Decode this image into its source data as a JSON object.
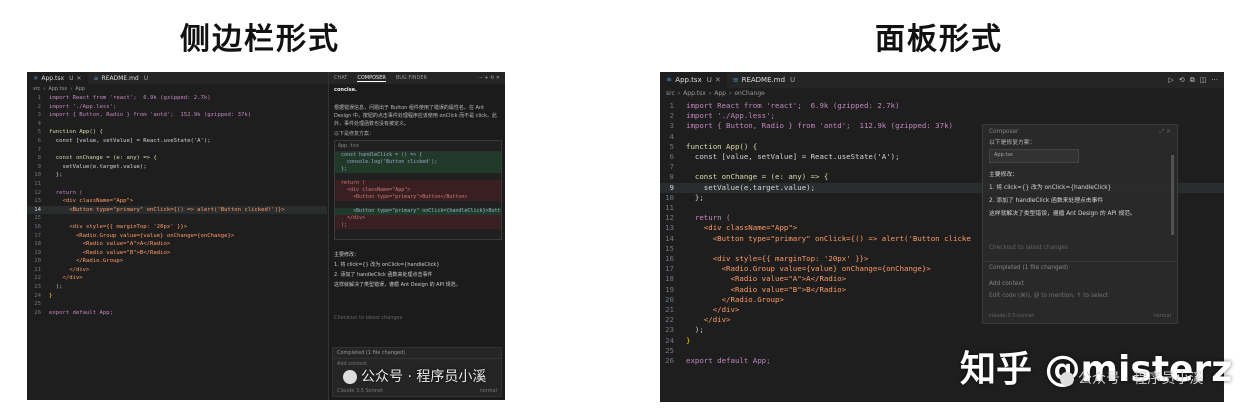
{
  "headings": {
    "left": "侧边栏形式",
    "right": "面板形式"
  },
  "editor": {
    "tabs": [
      {
        "label": "App.tsx",
        "status": "U",
        "active": true
      },
      {
        "label": "README.md",
        "status": "U",
        "active": false
      }
    ],
    "breadcrumb": [
      "src",
      "App.tsx",
      "App"
    ],
    "right_breadcrumb": [
      "src",
      "App.tsx",
      "App",
      "onChange"
    ],
    "lines": [
      {
        "n": "1",
        "text": "import React from 'react';  6.9k (gzipped: 2.7k)",
        "cls": "kw-import"
      },
      {
        "n": "2",
        "text": "import './App.less';",
        "cls": "kw-import"
      },
      {
        "n": "3",
        "text": "import { Button, Radio } from 'antd';  152.9k (gzipped: 37k)",
        "cls": "kw-import"
      },
      {
        "n": "4",
        "text": "",
        "cls": ""
      },
      {
        "n": "5",
        "text": "function App() {",
        "cls": "fn"
      },
      {
        "n": "6",
        "text": "  const [value, setValue] = React.useState('A');",
        "cls": "txt"
      },
      {
        "n": "7",
        "text": "",
        "cls": ""
      },
      {
        "n": "8",
        "text": "  const onChange = (e: any) => {",
        "cls": "fn"
      },
      {
        "n": "9",
        "text": "    setValue(e.target.value);",
        "cls": "txt"
      },
      {
        "n": "10",
        "text": "  };",
        "cls": "txt"
      },
      {
        "n": "11",
        "text": "",
        "cls": ""
      },
      {
        "n": "12",
        "text": "  return (",
        "cls": "kw"
      },
      {
        "n": "13",
        "text": "    <div className=\"App\">",
        "cls": "tag"
      },
      {
        "n": "14",
        "text": "      <Button type=\"primary\" onClick={() => alert('Button clicked!')}>",
        "cls": "tag"
      },
      {
        "n": "15",
        "text": "",
        "cls": ""
      },
      {
        "n": "16",
        "text": "      <div style={{ marginTop: '20px' }}>",
        "cls": "tag"
      },
      {
        "n": "17",
        "text": "        <Radio.Group value={value} onChange={onChange}>",
        "cls": "tag"
      },
      {
        "n": "18",
        "text": "          <Radio value=\"A\">A</Radio>",
        "cls": "tag"
      },
      {
        "n": "19",
        "text": "          <Radio value=\"B\">B</Radio>",
        "cls": "tag"
      },
      {
        "n": "20",
        "text": "        </Radio.Group>",
        "cls": "tag"
      },
      {
        "n": "21",
        "text": "      </div>",
        "cls": "tag"
      },
      {
        "n": "22",
        "text": "    </div>",
        "cls": "tag"
      },
      {
        "n": "23",
        "text": "  );",
        "cls": "txt"
      },
      {
        "n": "24",
        "text": "}",
        "cls": "brace"
      },
      {
        "n": "25",
        "text": "",
        "cls": ""
      },
      {
        "n": "26",
        "text": "export default App;",
        "cls": "kw-import"
      }
    ],
    "right_lines": [
      {
        "n": "1",
        "text": "import React from 'react';  6.9k (gzipped: 2.7k)",
        "cls": "kw-import"
      },
      {
        "n": "2",
        "text": "import './App.less';",
        "cls": "kw-import"
      },
      {
        "n": "3",
        "text": "import { Button, Radio } from 'antd';  112.9k (gzipped: 37k)",
        "cls": "kw-import"
      },
      {
        "n": "4",
        "text": "",
        "cls": ""
      },
      {
        "n": "5",
        "text": "function App() {",
        "cls": "fn"
      },
      {
        "n": "6",
        "text": "  const [value, setValue] = React.useState('A');",
        "cls": "txt"
      },
      {
        "n": "7",
        "text": "",
        "cls": ""
      },
      {
        "n": "8",
        "text": "  const onChange = (e: any) => {",
        "cls": "fn"
      },
      {
        "n": "9",
        "text": "    setValue(e.target.value);",
        "cls": "txt"
      },
      {
        "n": "10",
        "text": "  };",
        "cls": "txt"
      },
      {
        "n": "11",
        "text": "",
        "cls": ""
      },
      {
        "n": "12",
        "text": "  return (",
        "cls": "kw"
      },
      {
        "n": "13",
        "text": "    <div className=\"App\">",
        "cls": "tag"
      },
      {
        "n": "14",
        "text": "      <Button type=\"primary\" onClick={() => alert('Button clicke",
        "cls": "tag"
      },
      {
        "n": "15",
        "text": "",
        "cls": ""
      },
      {
        "n": "16",
        "text": "      <div style={{ marginTop: '20px' }}>",
        "cls": "tag"
      },
      {
        "n": "17",
        "text": "        <Radio.Group value={value} onChange={onChange}>",
        "cls": "tag"
      },
      {
        "n": "18",
        "text": "          <Radio value=\"A\">A</Radio>",
        "cls": "tag"
      },
      {
        "n": "19",
        "text": "          <Radio value=\"B\">B</Radio>",
        "cls": "tag"
      },
      {
        "n": "20",
        "text": "        </Radio.Group>",
        "cls": "tag"
      },
      {
        "n": "21",
        "text": "      </div>",
        "cls": "tag"
      },
      {
        "n": "22",
        "text": "    </div>",
        "cls": "tag"
      },
      {
        "n": "23",
        "text": "  );",
        "cls": "txt"
      },
      {
        "n": "24",
        "text": "}",
        "cls": "brace"
      },
      {
        "n": "25",
        "text": "",
        "cls": ""
      },
      {
        "n": "26",
        "text": "export default App;",
        "cls": "kw-import"
      }
    ],
    "left_highlight_line": "14",
    "right_highlight_line": "9"
  },
  "chat": {
    "tabs": [
      "CHAT",
      "COMPOSER",
      "BUG FINDER"
    ],
    "active_tab": "COMPOSER",
    "concise": "concise.",
    "para": "根据错误信息，问题出于 Button 组件使用了错误的属性名。在 Ant Design 中，按钮的点击事件处理程序应该使用 onClick 而不是 click。此外，事件处理函数也没有被定义。",
    "sub": "以下是修复方案：",
    "diff_file": "App.tsx",
    "diff_lines": [
      {
        "type": "add",
        "text": "const handleClick = () => {"
      },
      {
        "type": "add",
        "text": "  console.log('Button clicked');"
      },
      {
        "type": "add",
        "text": "};"
      },
      {
        "type": "neu",
        "text": ""
      },
      {
        "type": "del",
        "text": "return ("
      },
      {
        "type": "del",
        "text": "  <div className=\"App\">"
      },
      {
        "type": "del",
        "text": "    <Button type=\"primary\">Button</Button>"
      },
      {
        "type": "neu",
        "text": ""
      },
      {
        "type": "add",
        "text": "    <Button type=\"primary\" onClick={handleClick}>Butt"
      },
      {
        "type": "del",
        "text": "  </div>"
      },
      {
        "type": "del",
        "text": ");"
      }
    ],
    "list_title": "主要修改：",
    "list_1": "1. 将 click={} 改为 onClick={handleClick}",
    "list_2": "2. 添加了 handleClick 函数来处理点击事件",
    "list_3": "这样就解决了类型错误，遵循 Ant Design 的 API 规范。",
    "checkpoint": "Checkout to latest changes",
    "completed": "Completed (1 file changed)",
    "add_context": "Add context",
    "footer_left": "Claude 3.5 Sonnet",
    "footer_right": "normal"
  },
  "panel": {
    "title": "Composer",
    "sub": "以下是修复方案：",
    "file": "App.tsx",
    "body_title": "主要修改：",
    "item1": "1. 将 click={} 改为 onClick={handleClick}",
    "item2": "2. 添加了 handleClick 函数来处理点击事件",
    "item3": "这样就解决了类型错误，遵循 Ant Design 的 API 规范。",
    "checkpoint": "Checkout to latest changes",
    "completed": "Completed (1 file changed)",
    "add_context": "Add context",
    "input_placeholder": "Edit code (⌘I), @ to mention, ↑ to select",
    "footer_left": "claude-3.5-sonnet",
    "footer_right": "normal"
  },
  "watermarks": {
    "wechat_left": "公众号 · 程序员小溪",
    "zhihu": "知乎 @misterz",
    "wechat_right": "公众号 · 程序员小溪"
  }
}
